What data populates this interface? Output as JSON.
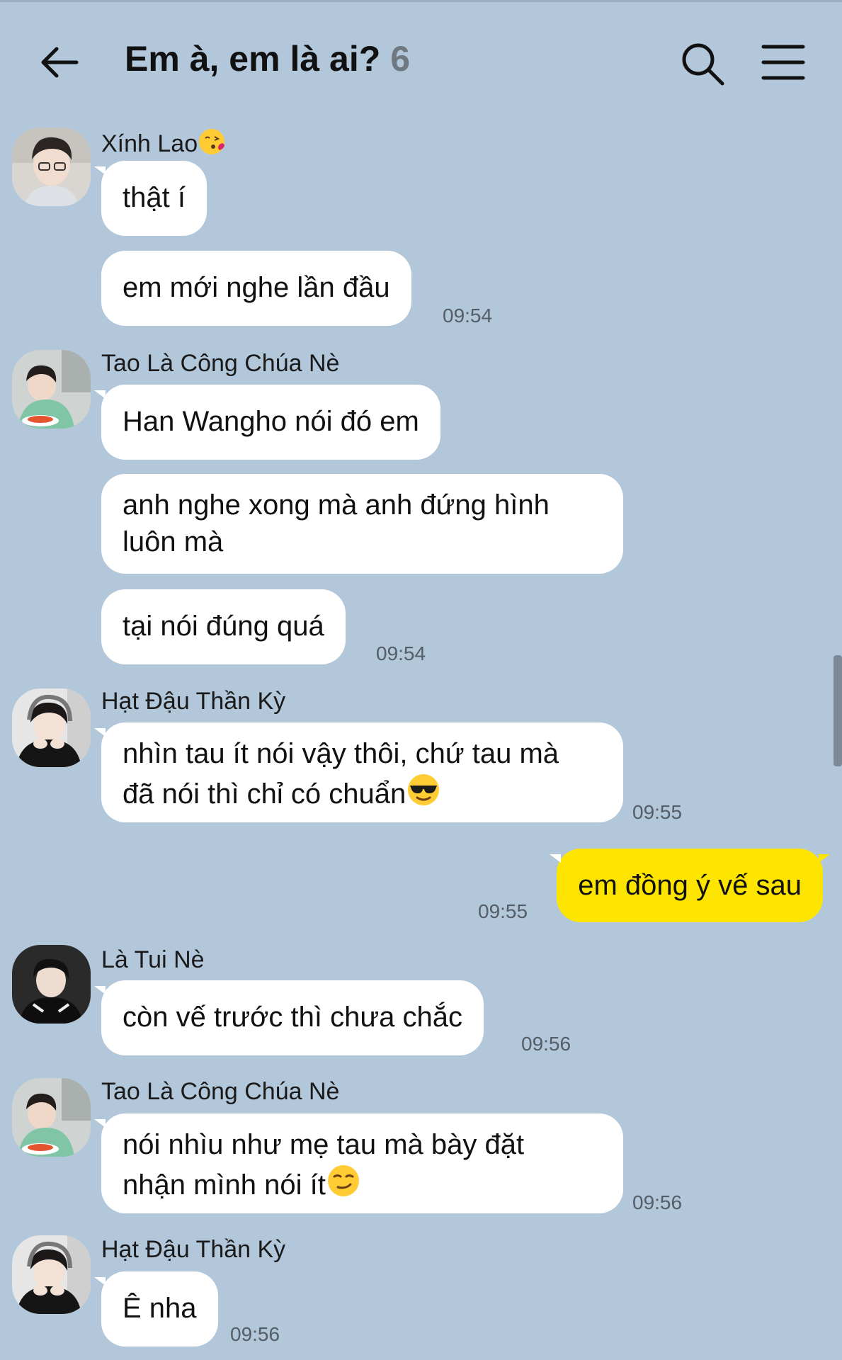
{
  "header": {
    "title": "Em à, em là ai?",
    "member_count": "6"
  },
  "messages": [
    {
      "sender": "Xính Lao",
      "sender_emoji": "kissing-emoji",
      "bubbles": [
        "thật í",
        "em mới nghe lần đầu"
      ],
      "time": "09:54"
    },
    {
      "sender": "Tao Là Công Chúa Nè",
      "bubbles": [
        "Han Wangho nói đó em",
        "anh nghe xong mà anh đứng hình",
        "luôn mà",
        "tại nói đúng quá"
      ],
      "time": "09:54"
    },
    {
      "sender": "Hạt Đậu Thần Kỳ",
      "bubbles": [
        "nhìn tau ít nói vậy thôi, chứ tau mà",
        "đã nói thì chỉ có chuẩn"
      ],
      "bubble_emoji": "sunglasses-emoji",
      "time": "09:55"
    },
    {
      "sender": "me",
      "bubbles": [
        "em đồng ý vế sau"
      ],
      "time": "09:55"
    },
    {
      "sender": "Là Tui Nè",
      "bubbles": [
        "còn vế trước thì chưa chắc"
      ],
      "time": "09:56"
    },
    {
      "sender": "Tao Là Công Chúa Nè",
      "bubbles": [
        "nói nhìu như mẹ tau mà bày đặt",
        "nhận mình nói ít"
      ],
      "bubble_emoji": "smirk-emoji",
      "time": "09:56"
    },
    {
      "sender": "Hạt Đậu Thần Kỳ",
      "bubbles": [
        "Ê nha"
      ],
      "time": "09:56"
    }
  ],
  "colors": {
    "background": "#b2c7da",
    "bubble_other": "#ffffff",
    "bubble_me": "#fee500"
  }
}
